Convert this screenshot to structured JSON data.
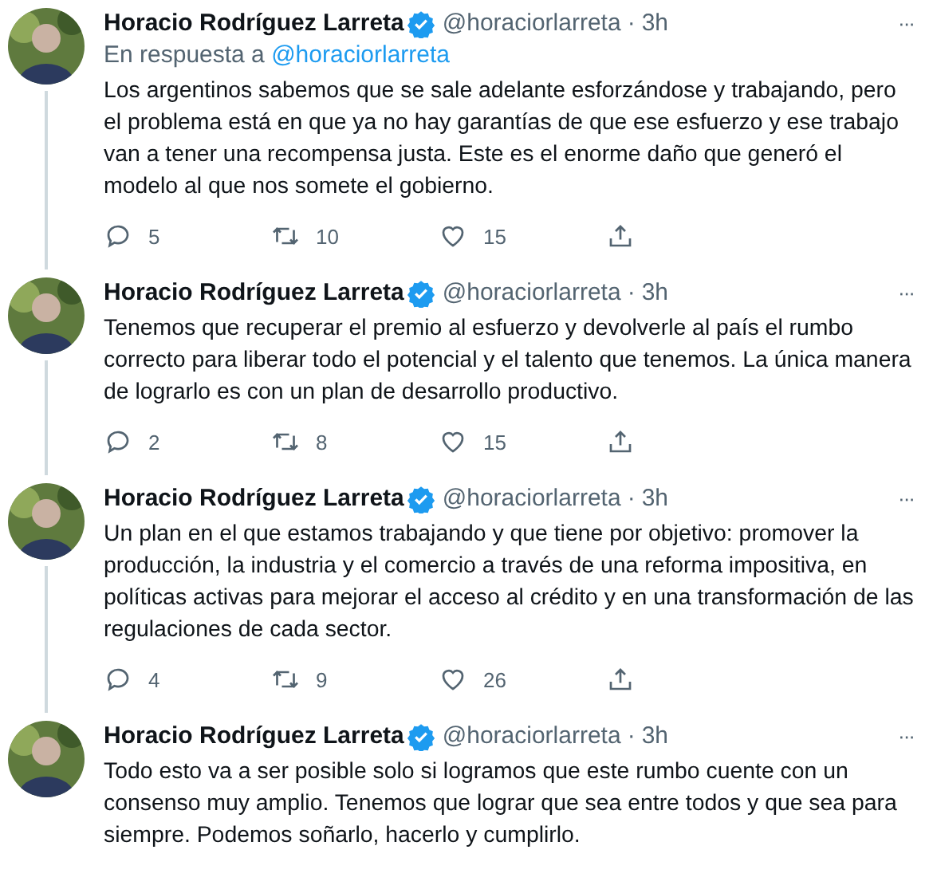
{
  "tweets": [
    {
      "name": "Horacio Rodríguez Larreta",
      "verified": true,
      "handle": "@horaciorlarreta",
      "separator": "·",
      "time": "3h",
      "more": "···",
      "reply_label": "En respuesta a",
      "reply_to": "@horaciorlarreta",
      "text": "Los argentinos sabemos que se sale adelante esforzándose y trabajando, pero el problema está en que ya no hay garantías de que ese esfuerzo y ese trabajo van a tener una recompensa justa. Este es el enorme daño que generó el modelo al que nos somete el gobierno.",
      "thread_line": true,
      "actions": {
        "replies": "5",
        "retweets": "10",
        "likes": "15"
      }
    },
    {
      "name": "Horacio Rodríguez Larreta",
      "verified": true,
      "handle": "@horaciorlarreta",
      "separator": "·",
      "time": "3h",
      "more": "···",
      "text": "Tenemos que recuperar el premio al esfuerzo y devolverle al país el rumbo correcto para liberar todo el potencial y el talento que tenemos. La única manera de lograrlo es con un plan de desarrollo productivo.",
      "thread_line": true,
      "actions": {
        "replies": "2",
        "retweets": "8",
        "likes": "15"
      }
    },
    {
      "name": "Horacio Rodríguez Larreta",
      "verified": true,
      "handle": "@horaciorlarreta",
      "separator": "·",
      "time": "3h",
      "more": "···",
      "text": "Un plan en el que estamos trabajando y que tiene por objetivo: promover la producción, la industria y el comercio a través de una reforma impositiva, en políticas activas para mejorar el acceso al crédito y en una transformación de las regulaciones de cada sector.",
      "thread_line": true,
      "actions": {
        "replies": "4",
        "retweets": "9",
        "likes": "26"
      }
    },
    {
      "name": "Horacio Rodríguez Larreta",
      "verified": true,
      "handle": "@horaciorlarreta",
      "separator": "·",
      "time": "3h",
      "more": "···",
      "text": "Todo esto va a ser posible solo si logramos que este rumbo cuente con un consenso muy amplio. Tenemos que lograr que sea entre todos y que sea para siempre. Podemos soñarlo, hacerlo y cumplirlo."
    }
  ]
}
